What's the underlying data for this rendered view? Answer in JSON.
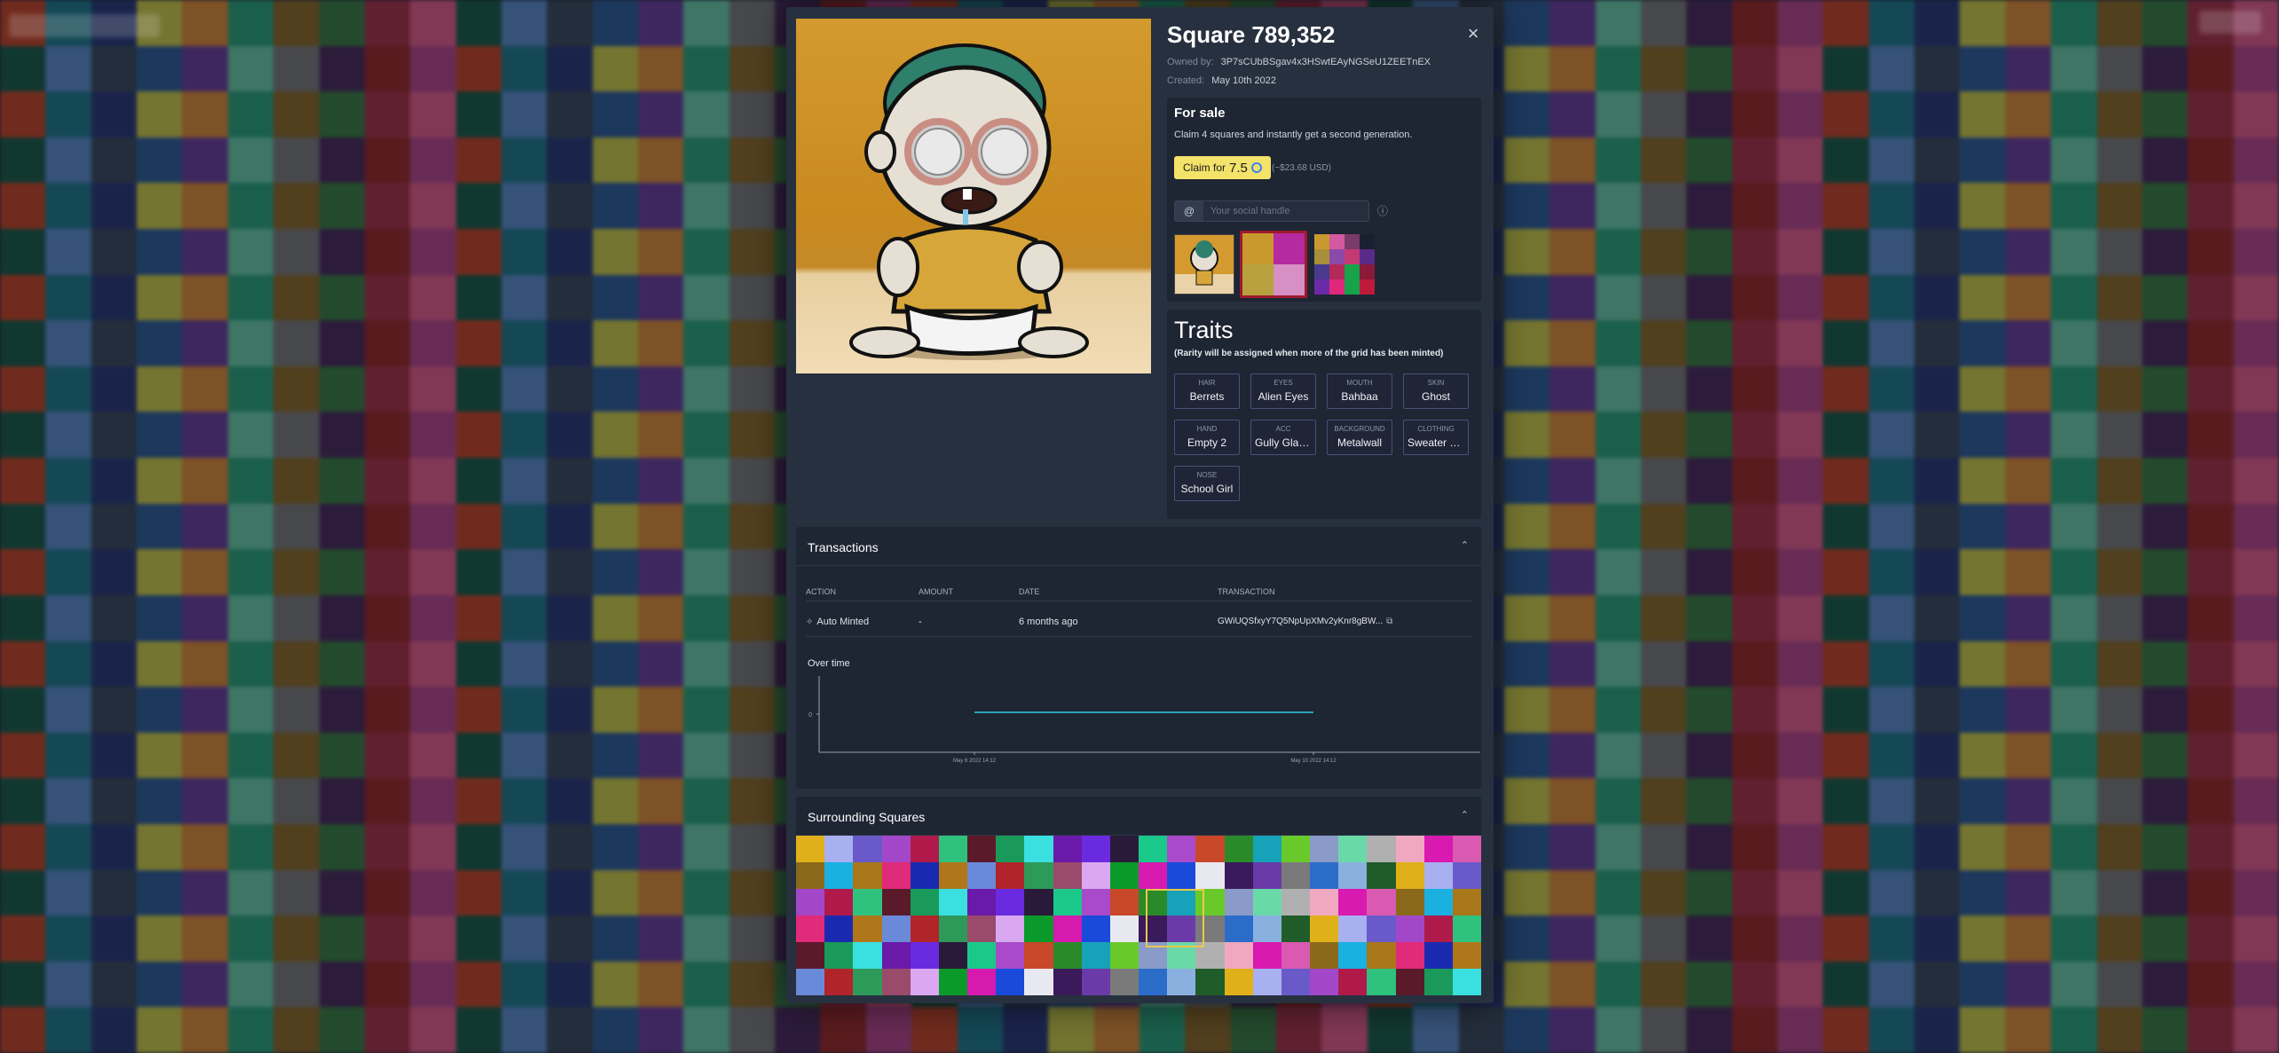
{
  "modal": {
    "title": "Square 789,352",
    "close_label": "×",
    "owned_by_label": "Owned by:",
    "owner": "3P7sCUbBSgav4x3HSwtEAyNGSeU1ZEETnEX",
    "created_label": "Created:",
    "created": "May 10th 2022"
  },
  "sale": {
    "heading": "For sale",
    "description": "Claim 4 squares and instantly get a second generation.",
    "claim_label": "Claim for",
    "claim_price": "7.5",
    "usd": "(~$23.68 USD)",
    "handle_prefix": "@",
    "handle_placeholder": "Your social handle"
  },
  "traits": {
    "heading": "Traits",
    "note": "(Rarity will be assigned when more of the grid has been minted)",
    "items": [
      {
        "key": "HAIR",
        "value": "Berrets"
      },
      {
        "key": "EYES",
        "value": "Alien Eyes"
      },
      {
        "key": "MOUTH",
        "value": "Bahbaa"
      },
      {
        "key": "SKIN",
        "value": "Ghost"
      },
      {
        "key": "HAND",
        "value": "Empty 2"
      },
      {
        "key": "ACC",
        "value": "Gully Glas..."
      },
      {
        "key": "BACKGROUND",
        "value": "Metalwall"
      },
      {
        "key": "CLOTHING",
        "value": "Sweater B..."
      },
      {
        "key": "NOSE",
        "value": "School Girl"
      }
    ]
  },
  "transactions": {
    "heading": "Transactions",
    "columns": [
      "ACTION",
      "AMOUNT",
      "DATE",
      "TRANSACTION"
    ],
    "rows": [
      {
        "action": "Auto Minted",
        "amount": "-",
        "date": "6 months ago",
        "tx": "GWiUQSfxyY7Q5NpUpXMv2yKnr8gBW..."
      }
    ],
    "over_time": "Over time"
  },
  "chart_data": {
    "type": "line",
    "title": "Over time",
    "x": [
      "May 6 2022 14:12",
      "May 10 2022 14:12"
    ],
    "series": [
      {
        "values": [
          0,
          0
        ]
      }
    ],
    "yticks": [
      "0"
    ],
    "xticks": [
      "May 6 2022 14:12",
      "May 10 2022 14:12"
    ]
  },
  "surrounding": {
    "heading": "Surrounding Squares"
  },
  "colors": {
    "accent_claim": "#f4e36a",
    "selected_border": "#9d1a2d",
    "chart_line": "#2aa3b8"
  }
}
